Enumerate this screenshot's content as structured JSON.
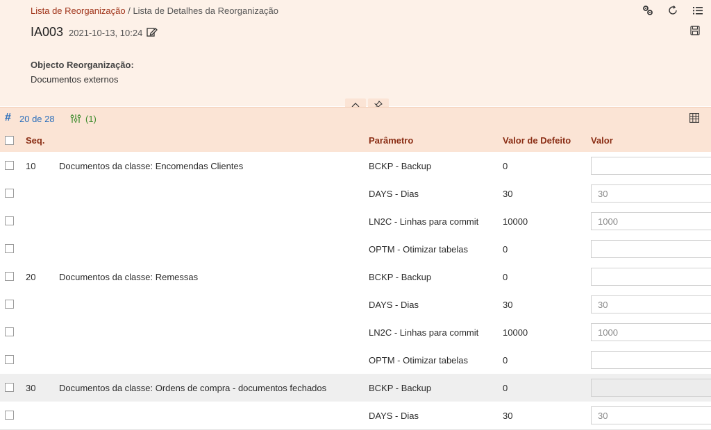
{
  "breadcrumb": {
    "link": "Lista de Reorganização",
    "separator": " / ",
    "current": "Lista de Detalhes da Reorganização"
  },
  "record": {
    "title": "IA003",
    "timestamp": "2021-10-13, 10:24"
  },
  "header_icons": [
    "settings-gears-icon",
    "refresh-icon",
    "list-menu-icon",
    "save-icon",
    "edit-icon"
  ],
  "field": {
    "label": "Objecto Reorganização:",
    "value": "Documentos externos"
  },
  "toolbar": {
    "count": "20 de 28",
    "filter_count": "(1)"
  },
  "columns": {
    "seq": "Seq.",
    "parametro": "Parâmetro",
    "valor_defeito": "Valor de Defeito",
    "valor": "Valor"
  },
  "rows": [
    {
      "seq": "10",
      "desc": "Documentos da classe: Encomendas Clientes",
      "param": "BCKP - Backup",
      "default": "0",
      "value": ""
    },
    {
      "seq": "",
      "desc": "",
      "param": "DAYS - Dias",
      "default": "30",
      "value": "30"
    },
    {
      "seq": "",
      "desc": "",
      "param": "LN2C - Linhas para commit",
      "default": "10000",
      "value": "1000"
    },
    {
      "seq": "",
      "desc": "",
      "param": "OPTM - Otimizar tabelas",
      "default": "0",
      "value": ""
    },
    {
      "seq": "20",
      "desc": "Documentos da classe: Remessas",
      "param": "BCKP - Backup",
      "default": "0",
      "value": ""
    },
    {
      "seq": "",
      "desc": "",
      "param": "DAYS - Dias",
      "default": "30",
      "value": "30"
    },
    {
      "seq": "",
      "desc": "",
      "param": "LN2C - Linhas para commit",
      "default": "10000",
      "value": "1000"
    },
    {
      "seq": "",
      "desc": "",
      "param": "OPTM - Otimizar tabelas",
      "default": "0",
      "value": ""
    },
    {
      "seq": "30",
      "desc": "Documentos da classe: Ordens de compra - documentos fechados",
      "param": "BCKP - Backup",
      "default": "0",
      "value": ""
    },
    {
      "seq": "",
      "desc": "",
      "param": "DAYS - Dias",
      "default": "30",
      "value": "30"
    }
  ],
  "colors": {
    "header_bg": "#fdf1e8",
    "toolbar_bg": "#fbe4d5",
    "link": "#a0341a",
    "column_header_text": "#8a2d14",
    "count_blue": "#2a6ebb",
    "filter_green": "#3a8a2a"
  }
}
